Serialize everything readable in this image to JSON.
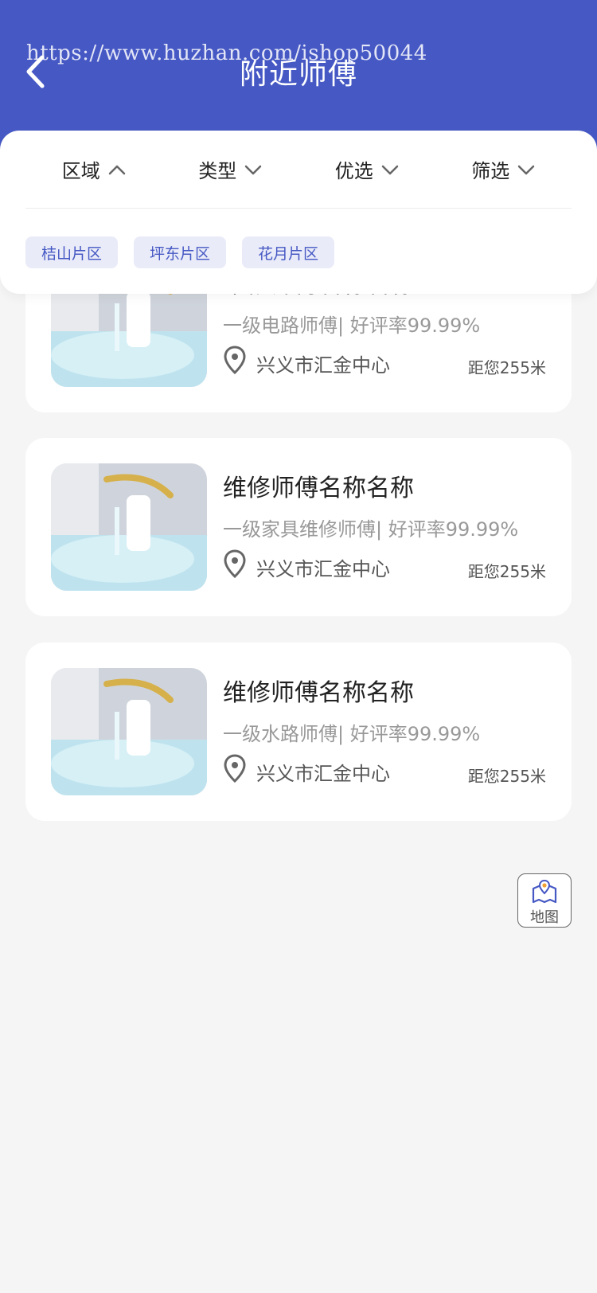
{
  "header": {
    "title": "附近师傅",
    "watermark": "https://www.huzhan.com/ishop50044"
  },
  "filters": {
    "tabs": [
      {
        "label": "区域",
        "state": "expanded"
      },
      {
        "label": "类型",
        "state": "collapsed"
      },
      {
        "label": "优选",
        "state": "collapsed"
      },
      {
        "label": "筛选",
        "state": "collapsed"
      }
    ],
    "chips": [
      "桔山片区",
      "坪东片区",
      "花月片区"
    ]
  },
  "masters": [
    {
      "name": "维修师傅名称名称",
      "desc": "一级电路师傅| 好评率99.99%",
      "address": "兴义市汇金中心",
      "distance": "距您255米"
    },
    {
      "name": "维修师傅名称名称",
      "desc": "一级家具维修师傅| 好评率99.99%",
      "address": "兴义市汇金中心",
      "distance": "距您255米"
    },
    {
      "name": "维修师傅名称名称",
      "desc": "一级水路师傅| 好评率99.99%",
      "address": "兴义市汇金中心",
      "distance": "距您255米"
    }
  ],
  "map_button": {
    "label": "地图"
  },
  "colors": {
    "accent": "#4658c4",
    "background": "#f5f5f5",
    "chip_bg": "#e9ebf8"
  }
}
